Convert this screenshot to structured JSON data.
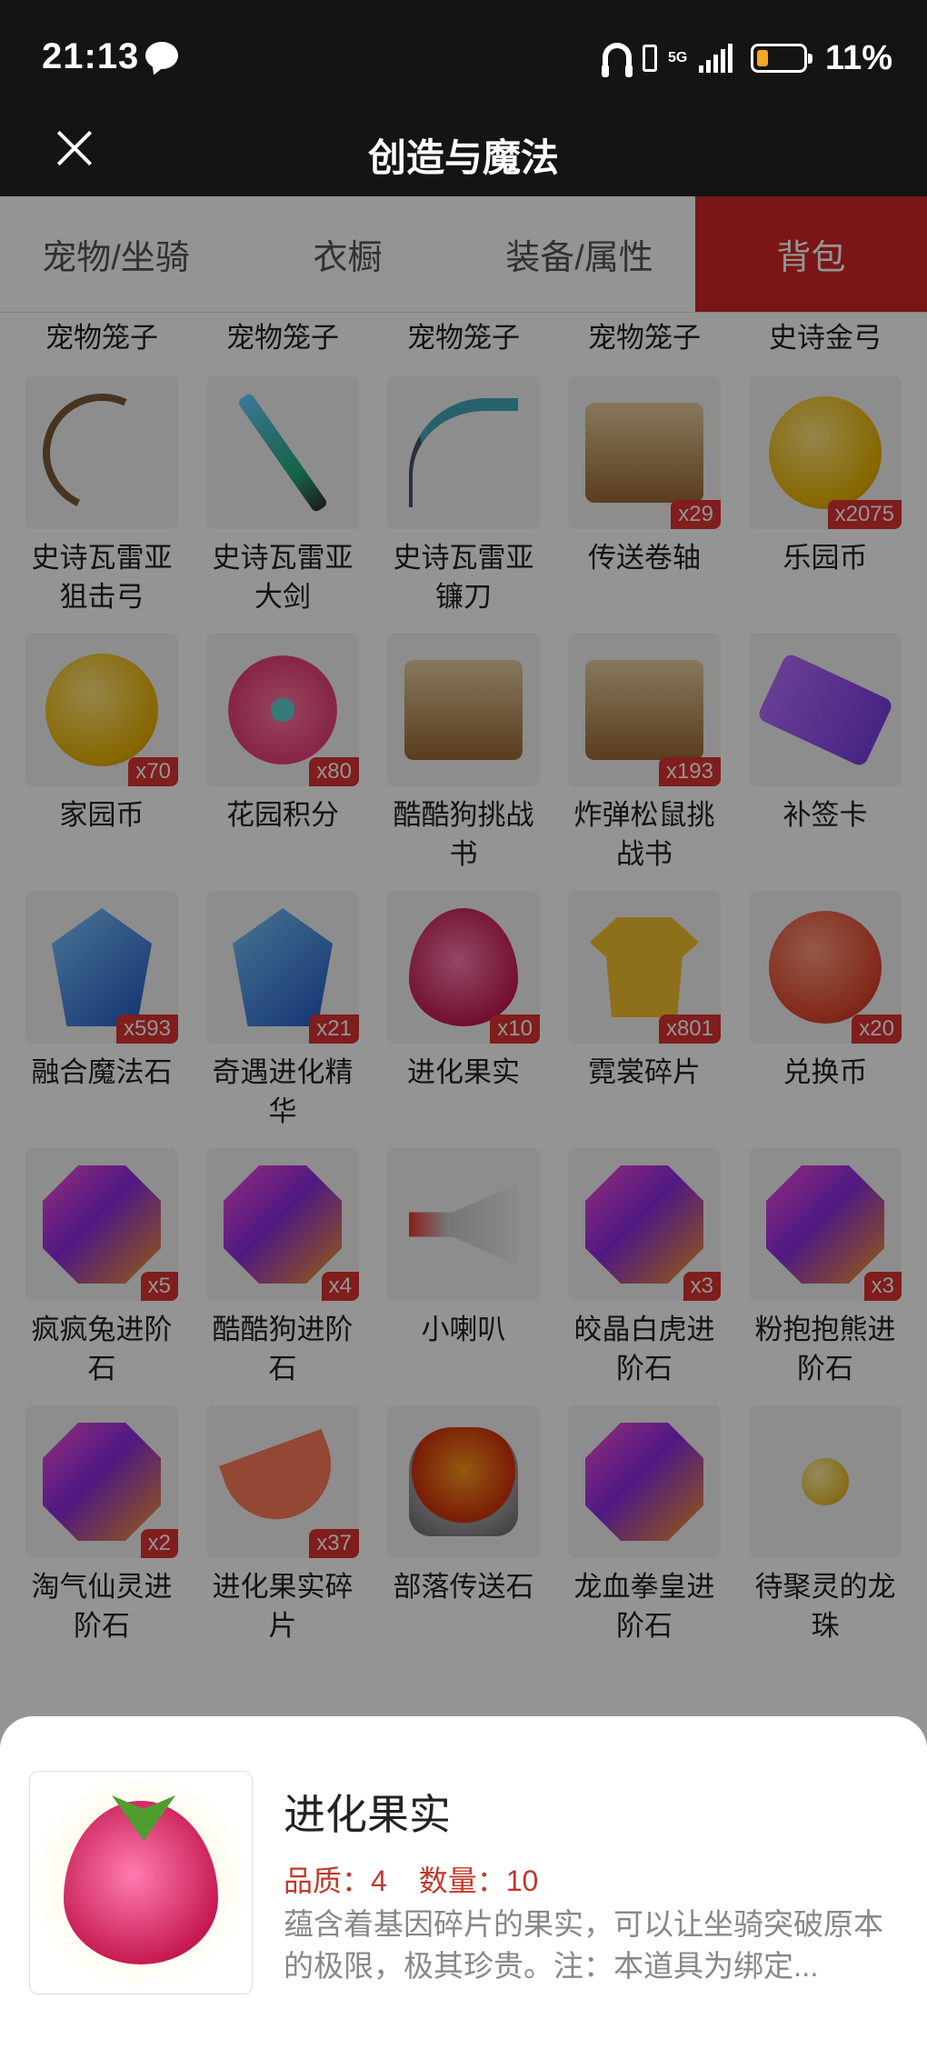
{
  "status_bar": {
    "time": "21:13",
    "network": "5G",
    "battery_percent": "11%",
    "battery_color": "#f5a623"
  },
  "header": {
    "title": "创造与魔法"
  },
  "tabs": [
    {
      "label": "宠物/坐骑",
      "active": false
    },
    {
      "label": "衣橱",
      "active": false
    },
    {
      "label": "装备/属性",
      "active": false
    },
    {
      "label": "背包",
      "active": true
    }
  ],
  "accent_color": "#d32626",
  "top_row_labels": [
    "宠物笼子",
    "宠物笼子",
    "宠物笼子",
    "宠物笼子",
    "史诗金弓"
  ],
  "items": [
    {
      "name": "史诗瓦雷亚\n狙击弓",
      "icon": "bow-icon",
      "count": ""
    },
    {
      "name": "史诗瓦雷亚\n大剑",
      "icon": "sword-icon",
      "count": ""
    },
    {
      "name": "史诗瓦雷亚\n镰刀",
      "icon": "scythe-icon",
      "count": ""
    },
    {
      "name": "传送卷轴",
      "icon": "scroll-icon",
      "count": "x29"
    },
    {
      "name": "乐园币",
      "icon": "gold-coin-icon",
      "count": "x2075"
    },
    {
      "name": "家园币",
      "icon": "gold-coin-icon",
      "count": "x70"
    },
    {
      "name": "花园积分",
      "icon": "flower-icon",
      "count": "x80"
    },
    {
      "name": "酷酷狗挑战\n书",
      "icon": "wanted-scroll-icon",
      "count": ""
    },
    {
      "name": "炸弹松鼠挑\n战书",
      "icon": "wanted-scroll-icon",
      "count": "x193"
    },
    {
      "name": "补签卡",
      "icon": "ticket-icon",
      "count": ""
    },
    {
      "name": "融合魔法石",
      "icon": "crystal-icon",
      "count": "x593"
    },
    {
      "name": "奇遇进化精\n华",
      "icon": "crystal-icon",
      "count": "x21"
    },
    {
      "name": "进化果实",
      "icon": "berry-icon",
      "count": "x10"
    },
    {
      "name": "霓裳碎片",
      "icon": "shirt-icon",
      "count": "x801"
    },
    {
      "name": "兑换币",
      "icon": "red-coin-icon",
      "count": "x20"
    },
    {
      "name": "疯疯兔进阶\n石",
      "icon": "gem-icon",
      "count": "x5"
    },
    {
      "name": "酷酷狗进阶\n石",
      "icon": "gem-icon",
      "count": "x4"
    },
    {
      "name": "小喇叭",
      "icon": "horn-icon",
      "count": ""
    },
    {
      "name": "皎晶白虎进\n阶石",
      "icon": "gem-icon",
      "count": "x3"
    },
    {
      "name": "粉抱抱熊进\n阶石",
      "icon": "gem-icon",
      "count": "x3"
    },
    {
      "name": "淘气仙灵进\n阶石",
      "icon": "gem-icon",
      "count": "x2"
    },
    {
      "name": "进化果实碎\n片",
      "icon": "fruit-slice-icon",
      "count": "x37"
    },
    {
      "name": "部落传送石",
      "icon": "stone-icon",
      "count": ""
    },
    {
      "name": "龙血拳皇进\n阶石",
      "icon": "gem-icon",
      "count": ""
    },
    {
      "name": "待聚灵的龙\n珠",
      "icon": "orb-icon",
      "count": ""
    }
  ],
  "detail": {
    "name": "进化果实",
    "quality": "品质：4",
    "quantity": "数量：10",
    "description": "蕴含着基因碎片的果实，可以让坐骑突破原本的极限，极其珍贵。注：本道具为绑定..."
  }
}
